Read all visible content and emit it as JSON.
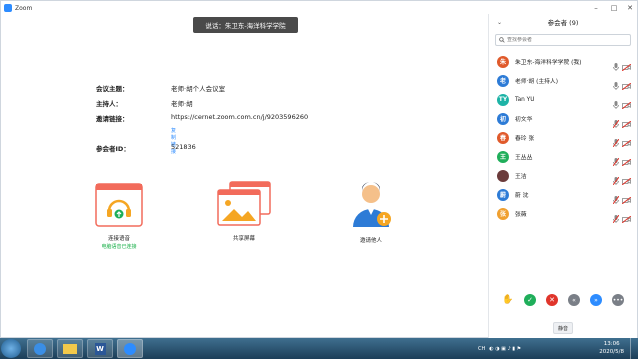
{
  "window": {
    "title": "Zoom"
  },
  "window_controls": [
    "–",
    "□",
    "✕"
  ],
  "speaking_banner": "说话：朱卫东-海洋科学学院",
  "meeting_info": {
    "topic_label": "会议主题：",
    "topic_value": "老师·胡个人会议室",
    "host_label": "主持人：",
    "host_value": "老师·胡",
    "invite_label": "邀请链接：",
    "invite_value": "https://cernet.zoom.com.cn/j/9203596260",
    "copy_link": "复制链接",
    "id_label": "参会者ID：",
    "id_value": "521836"
  },
  "actions": {
    "audio_label": "连接语音",
    "audio_status": "电脑语音已连接",
    "share_label": "共享屏幕",
    "invite_label": "邀请他人"
  },
  "panel": {
    "title": "参会者 (9)",
    "search_placeholder": "查找参会者",
    "participants": [
      {
        "avatar": "朱",
        "color": "#e05a2b",
        "name": "朱卫东-海洋科学学院 (我)"
      },
      {
        "avatar": "老",
        "color": "#2d7bd6",
        "name": "老师·胡 (主持人)"
      },
      {
        "avatar": "TY",
        "color": "#1db3a6",
        "name": "Tan YU"
      },
      {
        "avatar": "初",
        "color": "#2d7bd6",
        "name": "初文华"
      },
      {
        "avatar": "春",
        "color": "#e05a2b",
        "name": "春玲 张"
      },
      {
        "avatar": "王",
        "color": "#1fae5a",
        "name": "王丛丛"
      },
      {
        "avatar": "",
        "color": "#6b3b3b",
        "name": "王洁"
      },
      {
        "avatar": "蔚",
        "color": "#2d7bd6",
        "name": "蔚 沈"
      },
      {
        "avatar": "张",
        "color": "#f0a030",
        "name": "张薇"
      }
    ],
    "mute_all": "静音"
  },
  "taskbar": {
    "tray_text": "CH",
    "time": "13:06",
    "date": "2020/5/8"
  }
}
